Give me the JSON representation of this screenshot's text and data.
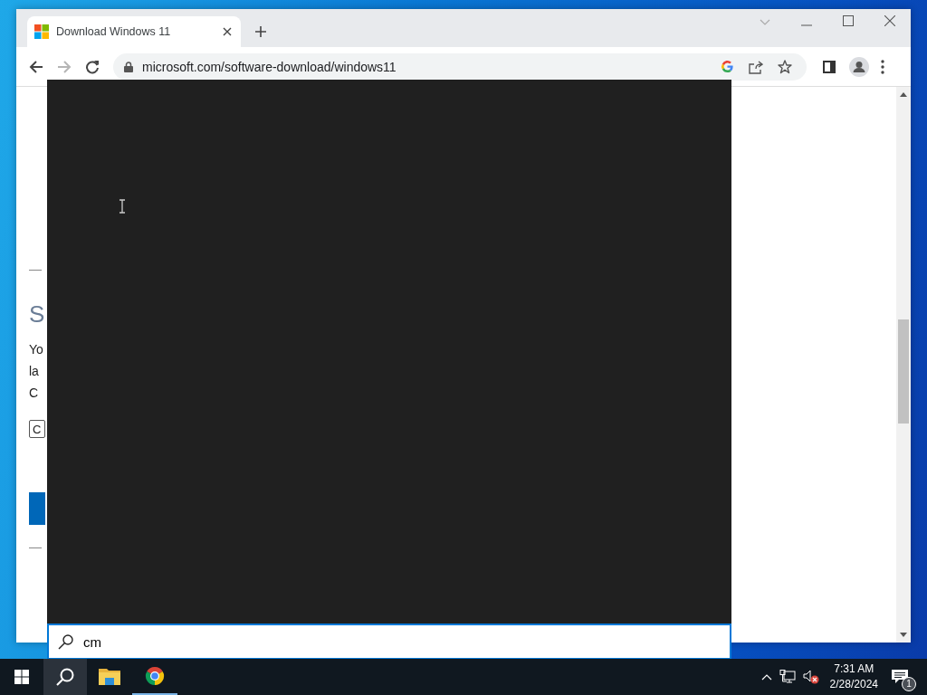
{
  "browser": {
    "tab": {
      "title": "Download Windows 11",
      "selected": true
    },
    "address": "microsoft.com/software-download/windows11"
  },
  "page": {
    "heading": "S",
    "lines": [
      "Yo",
      "la",
      "C"
    ],
    "dropdown": "C"
  },
  "search_panel": {
    "query": "cm"
  },
  "taskbar": {
    "search_button": {
      "selected": true
    },
    "apps": [
      {
        "kind": "files",
        "running": false
      },
      {
        "kind": "chrome",
        "running": true
      }
    ],
    "time": "7:31 AM",
    "date": "2/28/2024",
    "notification_count": "1"
  }
}
